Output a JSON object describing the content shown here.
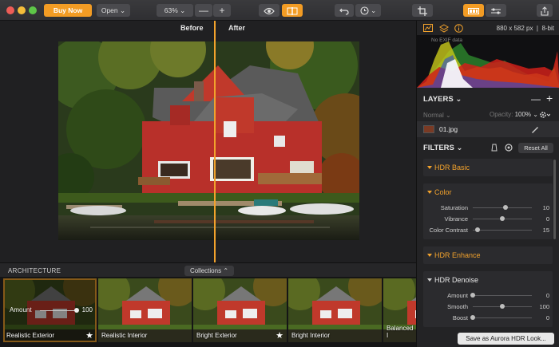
{
  "toolbar": {
    "buy_label": "Buy Now",
    "open_label": "Open",
    "zoom_label": "63%",
    "minus": "—",
    "plus": "+"
  },
  "compare": {
    "before": "Before",
    "after": "After"
  },
  "presets": {
    "category": "ARCHITECTURE",
    "collections_label": "Collections",
    "amount_label": "Amount",
    "amount_value": "100",
    "amount_fraction": 1.0,
    "items": [
      {
        "label": "Realistic Exterior",
        "selected": true,
        "starred": true
      },
      {
        "label": "Realistic Interior",
        "selected": false,
        "starred": false
      },
      {
        "label": "Bright Exterior",
        "selected": false,
        "starred": true
      },
      {
        "label": "Bright Interior",
        "selected": false,
        "starred": false
      },
      {
        "label": "Balanced I",
        "selected": false,
        "starred": false
      }
    ]
  },
  "panel": {
    "dimensions": "880 x 582 px",
    "bit_depth": "8-bit",
    "no_exif": "No EXIF data",
    "layers_title": "LAYERS",
    "blend_mode": "Normal",
    "opacity_label": "Opacity:",
    "opacity_value": "100%",
    "layer_name": "01.jpg",
    "filters_title": "FILTERS",
    "reset_all": "Reset All",
    "filters": [
      {
        "name": "HDR Basic",
        "expanded": false
      },
      {
        "name": "Color",
        "expanded": true,
        "sliders": [
          {
            "label": "Saturation",
            "value": "10",
            "fraction": 0.55
          },
          {
            "label": "Vibrance",
            "value": "0",
            "fraction": 0.5
          },
          {
            "label": "Color Contrast",
            "value": "15",
            "fraction": 0.08
          }
        ]
      },
      {
        "name": "HDR Enhance",
        "expanded": false
      },
      {
        "name": "HDR Denoise",
        "expanded": true,
        "sliders": [
          {
            "label": "Amount",
            "value": "0",
            "fraction": 0.0
          },
          {
            "label": "Smooth",
            "value": "100",
            "fraction": 0.5
          },
          {
            "label": "Boost",
            "value": "0",
            "fraction": 0.0
          }
        ]
      }
    ],
    "save_label": "Save as Aurora HDR Look..."
  },
  "colors": {
    "accent": "#f2a22c",
    "buy": "#f39c24"
  }
}
